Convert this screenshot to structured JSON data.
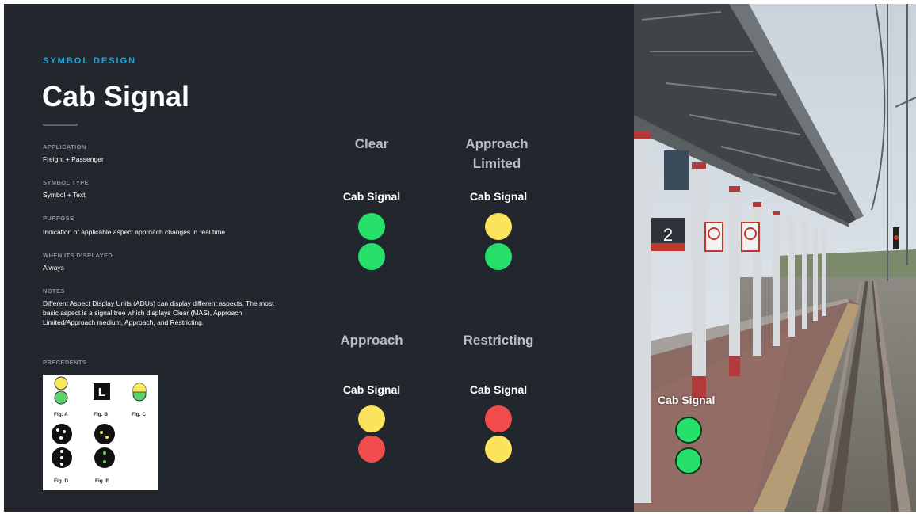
{
  "header": {
    "eyebrow": "SYMBOL DESIGN",
    "title": "Cab Signal"
  },
  "details": [
    {
      "label": "APPLICATION",
      "value": "Freight + Passenger"
    },
    {
      "label": "SYMBOL TYPE",
      "value": "Symbol + Text"
    },
    {
      "label": "PURPOSE",
      "value": "Indication of applicable aspect approach changes in real time"
    },
    {
      "label": "WHEN ITS DISPLAYED",
      "value": "Always"
    },
    {
      "label": "NOTES",
      "value": "Different Aspect Display Units (ADUs) can display different aspects. The most basic aspect is a signal tree which displays Clear (MAS), Approach Limited/Approach medium, Approach, and Restricting."
    }
  ],
  "precedents": {
    "label": "PRECEDENTS",
    "figures": [
      "Fig. A",
      "Fig. B",
      "Fig. C",
      "Fig. D",
      "Fig. E"
    ],
    "fig_b_letter": "L"
  },
  "signals": [
    {
      "name": "Clear",
      "caption": "Cab Signal",
      "lamps": [
        "green",
        "green"
      ]
    },
    {
      "name": "Approach Limited",
      "caption": "Cab Signal",
      "lamps": [
        "yellow",
        "green"
      ]
    },
    {
      "name": "Approach",
      "caption": "Cab Signal",
      "lamps": [
        "yellow",
        "red"
      ]
    },
    {
      "name": "Restricting",
      "caption": "Cab Signal",
      "lamps": [
        "red",
        "yellow"
      ]
    }
  ],
  "colors": {
    "panel_bg": "#22272e",
    "accent": "#1ea7e2",
    "green": "#27e06b",
    "yellow": "#fbe35b",
    "red": "#f14b4b"
  },
  "photo": {
    "caption": "Cab Signal",
    "platform_number": "2",
    "lamps": [
      "green",
      "green"
    ]
  }
}
